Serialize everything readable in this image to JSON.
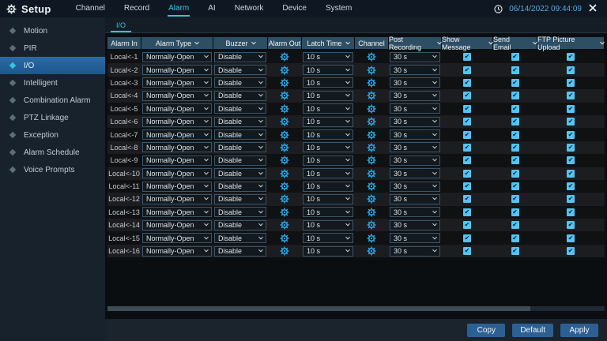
{
  "topbar": {
    "title": "Setup",
    "menu": [
      {
        "label": "Channel"
      },
      {
        "label": "Record"
      },
      {
        "label": "Alarm",
        "active": true
      },
      {
        "label": "AI"
      },
      {
        "label": "Network"
      },
      {
        "label": "Device"
      },
      {
        "label": "System"
      }
    ],
    "datetime": "06/14/2022 09:44:09"
  },
  "sidebar": {
    "items": [
      {
        "label": "Motion"
      },
      {
        "label": "PIR"
      },
      {
        "label": "I/O",
        "active": true
      },
      {
        "label": "Intelligent"
      },
      {
        "label": "Combination Alarm"
      },
      {
        "label": "PTZ Linkage"
      },
      {
        "label": "Exception"
      },
      {
        "label": "Alarm Schedule"
      },
      {
        "label": "Voice Prompts"
      }
    ]
  },
  "tab": {
    "label": "I/O"
  },
  "table": {
    "headers": [
      {
        "label": "Alarm In",
        "chevron": false
      },
      {
        "label": "Alarm Type",
        "chevron": true
      },
      {
        "label": "Buzzer",
        "chevron": true
      },
      {
        "label": "Alarm Out",
        "chevron": false
      },
      {
        "label": "Latch Time",
        "chevron": true
      },
      {
        "label": "Channel",
        "chevron": false
      },
      {
        "label": "Post Recording",
        "chevron": true
      },
      {
        "label": "Show Message",
        "chevron": true
      },
      {
        "label": "Send Email",
        "chevron": true
      },
      {
        "label": "FTP Picture Upload",
        "chevron": true
      }
    ],
    "rows": [
      {
        "alarm_in": "Local<-1",
        "alarm_type": "Normally-Open",
        "buzzer": "Disable",
        "latch_time": "10 s",
        "post_recording": "30 s",
        "show_message": true,
        "send_email": true,
        "ftp_picture_upload": true
      },
      {
        "alarm_in": "Local<-2",
        "alarm_type": "Normally-Open",
        "buzzer": "Disable",
        "latch_time": "10 s",
        "post_recording": "30 s",
        "show_message": true,
        "send_email": true,
        "ftp_picture_upload": true
      },
      {
        "alarm_in": "Local<-3",
        "alarm_type": "Normally-Open",
        "buzzer": "Disable",
        "latch_time": "10 s",
        "post_recording": "30 s",
        "show_message": true,
        "send_email": true,
        "ftp_picture_upload": true
      },
      {
        "alarm_in": "Local<-4",
        "alarm_type": "Normally-Open",
        "buzzer": "Disable",
        "latch_time": "10 s",
        "post_recording": "30 s",
        "show_message": true,
        "send_email": true,
        "ftp_picture_upload": true
      },
      {
        "alarm_in": "Local<-5",
        "alarm_type": "Normally-Open",
        "buzzer": "Disable",
        "latch_time": "10 s",
        "post_recording": "30 s",
        "show_message": true,
        "send_email": true,
        "ftp_picture_upload": true
      },
      {
        "alarm_in": "Local<-6",
        "alarm_type": "Normally-Open",
        "buzzer": "Disable",
        "latch_time": "10 s",
        "post_recording": "30 s",
        "show_message": true,
        "send_email": true,
        "ftp_picture_upload": true
      },
      {
        "alarm_in": "Local<-7",
        "alarm_type": "Normally-Open",
        "buzzer": "Disable",
        "latch_time": "10 s",
        "post_recording": "30 s",
        "show_message": true,
        "send_email": true,
        "ftp_picture_upload": true
      },
      {
        "alarm_in": "Local<-8",
        "alarm_type": "Normally-Open",
        "buzzer": "Disable",
        "latch_time": "10 s",
        "post_recording": "30 s",
        "show_message": true,
        "send_email": true,
        "ftp_picture_upload": true
      },
      {
        "alarm_in": "Local<-9",
        "alarm_type": "Normally-Open",
        "buzzer": "Disable",
        "latch_time": "10 s",
        "post_recording": "30 s",
        "show_message": true,
        "send_email": true,
        "ftp_picture_upload": true
      },
      {
        "alarm_in": "Local<-10",
        "alarm_type": "Normally-Open",
        "buzzer": "Disable",
        "latch_time": "10 s",
        "post_recording": "30 s",
        "show_message": true,
        "send_email": true,
        "ftp_picture_upload": true
      },
      {
        "alarm_in": "Local<-11",
        "alarm_type": "Normally-Open",
        "buzzer": "Disable",
        "latch_time": "10 s",
        "post_recording": "30 s",
        "show_message": true,
        "send_email": true,
        "ftp_picture_upload": true
      },
      {
        "alarm_in": "Local<-12",
        "alarm_type": "Normally-Open",
        "buzzer": "Disable",
        "latch_time": "10 s",
        "post_recording": "30 s",
        "show_message": true,
        "send_email": true,
        "ftp_picture_upload": true
      },
      {
        "alarm_in": "Local<-13",
        "alarm_type": "Normally-Open",
        "buzzer": "Disable",
        "latch_time": "10 s",
        "post_recording": "30 s",
        "show_message": true,
        "send_email": true,
        "ftp_picture_upload": true
      },
      {
        "alarm_in": "Local<-14",
        "alarm_type": "Normally-Open",
        "buzzer": "Disable",
        "latch_time": "10 s",
        "post_recording": "30 s",
        "show_message": true,
        "send_email": true,
        "ftp_picture_upload": true
      },
      {
        "alarm_in": "Local<-15",
        "alarm_type": "Normally-Open",
        "buzzer": "Disable",
        "latch_time": "10 s",
        "post_recording": "30 s",
        "show_message": true,
        "send_email": true,
        "ftp_picture_upload": true
      },
      {
        "alarm_in": "Local<-16",
        "alarm_type": "Normally-Open",
        "buzzer": "Disable",
        "latch_time": "10 s",
        "post_recording": "30 s",
        "show_message": true,
        "send_email": true,
        "ftp_picture_upload": true
      }
    ]
  },
  "footer": {
    "copy_label": "Copy",
    "default_label": "Default",
    "apply_label": "Apply"
  },
  "colors": {
    "accent_cyan": "#35c3db",
    "checkbox_blue": "#55c4f2",
    "button_blue": "#2c6093",
    "header_cell": "#2e4e64",
    "sidebar_selected": "#24619c"
  }
}
